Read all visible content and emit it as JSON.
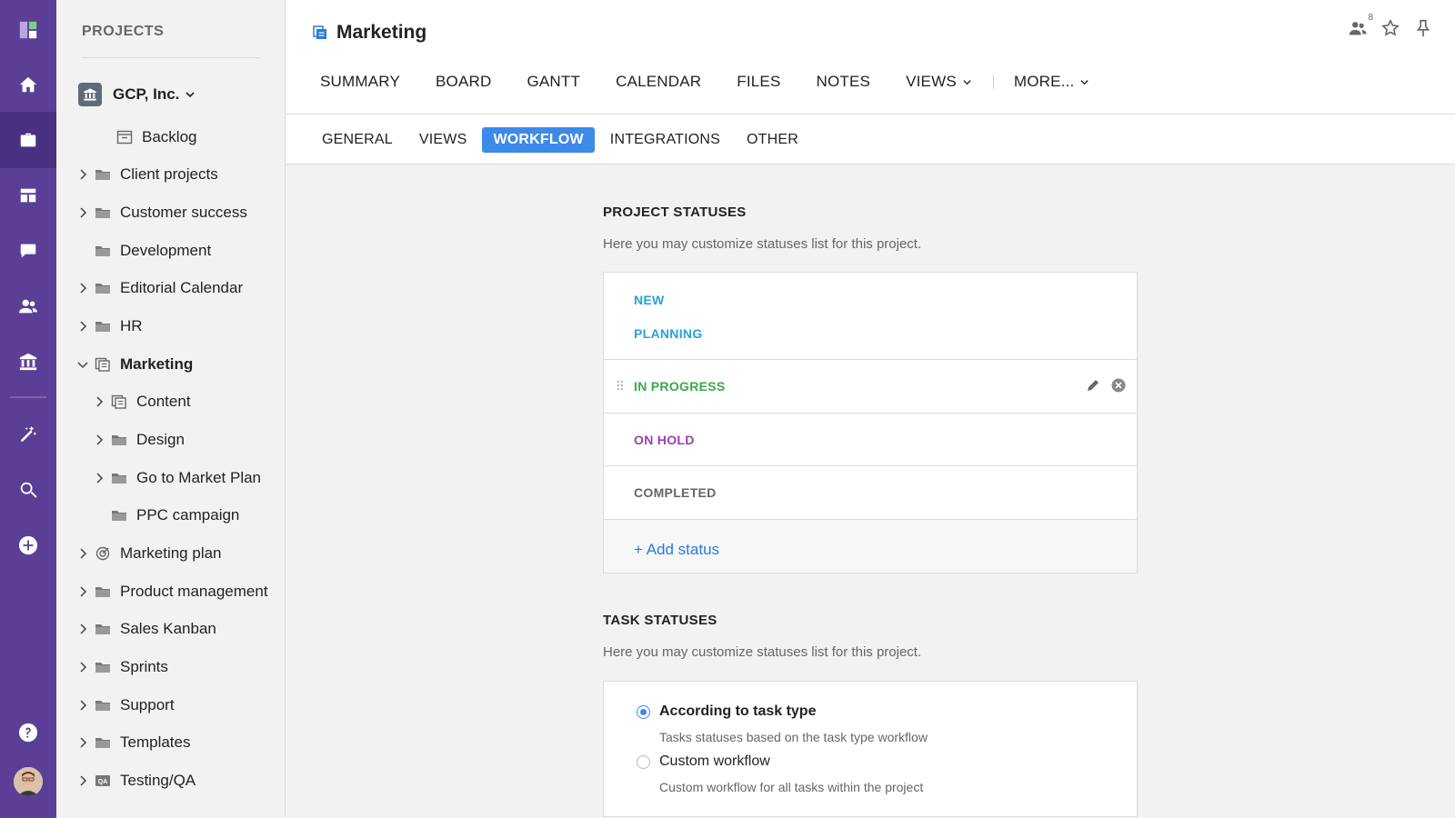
{
  "sidebar": {
    "title": "PROJECTS",
    "org_name": "GCP, Inc.",
    "items": [
      {
        "label": "Backlog"
      },
      {
        "label": "Client projects"
      },
      {
        "label": "Customer success"
      },
      {
        "label": "Development"
      },
      {
        "label": "Editorial Calendar"
      },
      {
        "label": "HR"
      },
      {
        "label": "Marketing"
      },
      {
        "label": "Content"
      },
      {
        "label": "Design"
      },
      {
        "label": "Go to Market Plan"
      },
      {
        "label": "PPC campaign"
      },
      {
        "label": "Marketing plan"
      },
      {
        "label": "Product management"
      },
      {
        "label": "Sales Kanban"
      },
      {
        "label": "Sprints"
      },
      {
        "label": "Support"
      },
      {
        "label": "Templates"
      },
      {
        "label": "Testing/QA"
      }
    ]
  },
  "header": {
    "title": "Marketing",
    "member_count": "8",
    "tabs": [
      "SUMMARY",
      "BOARD",
      "GANTT",
      "CALENDAR",
      "FILES",
      "NOTES",
      "VIEWS",
      "MORE..."
    ]
  },
  "subtabs": [
    "GENERAL",
    "VIEWS",
    "WORKFLOW",
    "INTEGRATIONS",
    "OTHER"
  ],
  "project_statuses": {
    "title": "PROJECT STATUSES",
    "description": "Here you may customize statuses list for this project.",
    "statuses": [
      {
        "label": "NEW",
        "color": "#2aa0d8"
      },
      {
        "label": "PLANNING",
        "color": "#2aa0d8"
      },
      {
        "label": "IN PROGRESS",
        "color": "#3aa84a"
      },
      {
        "label": "ON HOLD",
        "color": "#9a3fb0"
      },
      {
        "label": "COMPLETED",
        "color": "#666666"
      }
    ],
    "add_label": "+ Add status"
  },
  "task_statuses": {
    "title": "TASK STATUSES",
    "description": "Here you may customize statuses list for this project.",
    "options": [
      {
        "label": "According to task type",
        "sub": "Tasks statuses based on the task type workflow",
        "selected": true
      },
      {
        "label": "Custom workflow",
        "sub": "Custom workflow for all tasks within the project",
        "selected": false
      }
    ]
  },
  "colors": {
    "rail": "#5b3e96",
    "accent": "#3d8ae8",
    "link": "#2a7bd8"
  }
}
